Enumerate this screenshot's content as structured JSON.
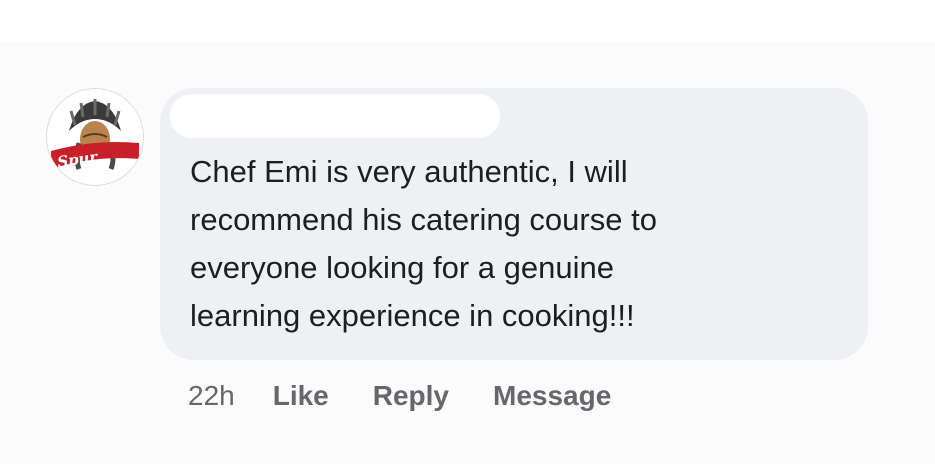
{
  "comment": {
    "author": {
      "name": "",
      "avatar_icon": "spur-logo-icon",
      "avatar_text": "Spur"
    },
    "text": "Chef Emi is very authentic, I will\nrecommend his catering course to\neveryone looking for a genuine\nlearning experience in cooking!!!",
    "bubble_color": "#eef0f4",
    "text_color": "#1c1e21"
  },
  "actions": {
    "timestamp": "22h",
    "like_label": "Like",
    "reply_label": "Reply",
    "message_label": "Message",
    "color": "#65676b"
  }
}
